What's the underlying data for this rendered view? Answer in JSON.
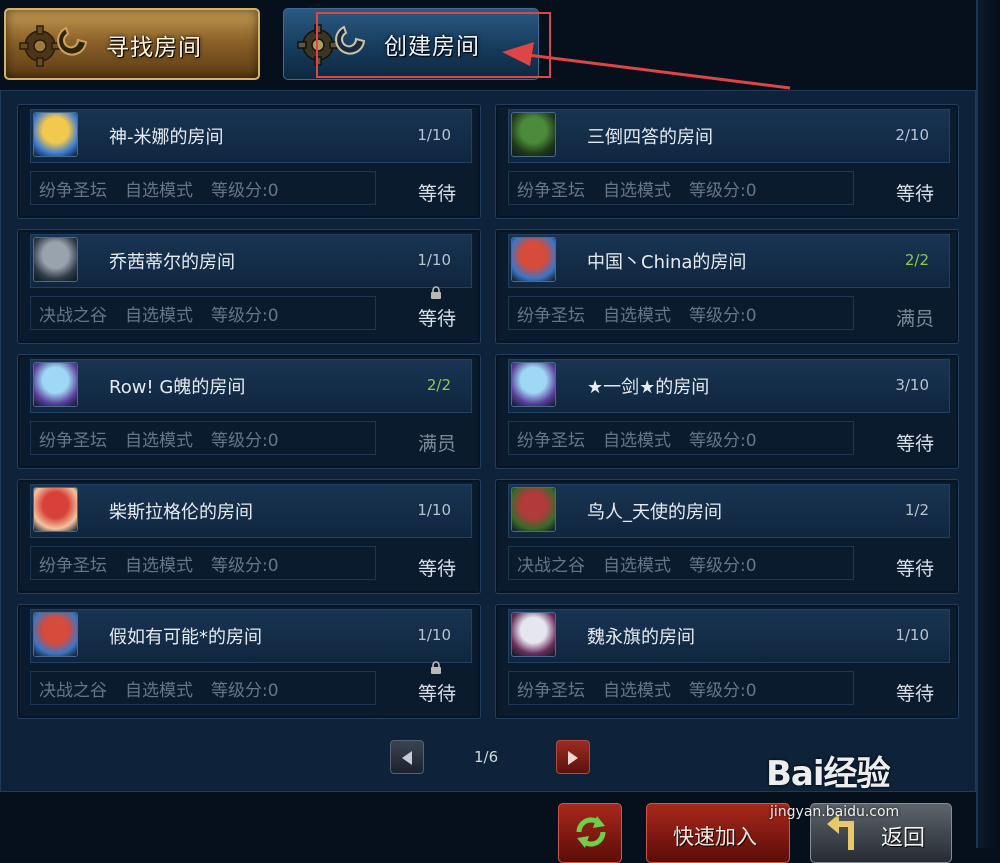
{
  "tabs": {
    "find_label": "寻找房间",
    "create_label": "创建房间"
  },
  "rooms": [
    {
      "name": "神-米娜的房间",
      "count": "1/10",
      "map": "纷争圣坛",
      "mode": "自选模式",
      "level": "等级分:0",
      "status": "等待",
      "full": false,
      "locked": false,
      "avatar": "blonde-hero"
    },
    {
      "name": "三倒四答的房间",
      "count": "2/10",
      "map": "纷争圣坛",
      "mode": "自选模式",
      "level": "等级分:0",
      "status": "等待",
      "full": false,
      "locked": false,
      "avatar": "green-monster"
    },
    {
      "name": "乔茜蒂尔的房间",
      "count": "1/10",
      "map": "决战之谷",
      "mode": "自选模式",
      "level": "等级分:0",
      "status": "等待",
      "full": false,
      "locked": true,
      "avatar": "robot-hero"
    },
    {
      "name": "中国丶China的房间",
      "count": "2/2",
      "map": "纷争圣坛",
      "mode": "自选模式",
      "level": "等级分:0",
      "status": "满员",
      "full": true,
      "locked": false,
      "avatar": "helmet-hero"
    },
    {
      "name": "Row! G魄的房间",
      "count": "2/2",
      "map": "纷争圣坛",
      "mode": "自选模式",
      "level": "等级分:0",
      "status": "满员",
      "full": true,
      "locked": false,
      "avatar": "ice-girl"
    },
    {
      "name": "★一剑★的房间",
      "count": "3/10",
      "map": "纷争圣坛",
      "mode": "自选模式",
      "level": "等级分:0",
      "status": "等待",
      "full": false,
      "locked": false,
      "avatar": "ice-girl"
    },
    {
      "name": "柴斯拉格伦的房间",
      "count": "1/10",
      "map": "纷争圣坛",
      "mode": "自选模式",
      "level": "等级分:0",
      "status": "等待",
      "full": false,
      "locked": false,
      "avatar": "red-hair-girl"
    },
    {
      "name": "鸟人_天使的房间",
      "count": "1/2",
      "map": "决战之谷",
      "mode": "自选模式",
      "level": "等级分:0",
      "status": "等待",
      "full": false,
      "locked": false,
      "avatar": "bird-warrior"
    },
    {
      "name": "假如有可能*的房间",
      "count": "1/10",
      "map": "决战之谷",
      "mode": "自选模式",
      "level": "等级分:0",
      "status": "等待",
      "full": false,
      "locked": true,
      "avatar": "helmet-hero"
    },
    {
      "name": "魏永旗的房间",
      "count": "1/10",
      "map": "纷争圣坛",
      "mode": "自选模式",
      "level": "等级分:0",
      "status": "等待",
      "full": false,
      "locked": false,
      "avatar": "white-hair-hero"
    }
  ],
  "pagination": {
    "indicator": "1/6"
  },
  "bottom": {
    "quick_join_label": "快速加入",
    "back_label": "返回"
  },
  "watermark": {
    "logo": "Bai经验",
    "site": "jingyan.baidu.com"
  },
  "colors": {
    "highlight": "#e04545",
    "full_count": "#8fc85a",
    "find_tab": "#8c6229",
    "create_tab": "#163c5c"
  }
}
